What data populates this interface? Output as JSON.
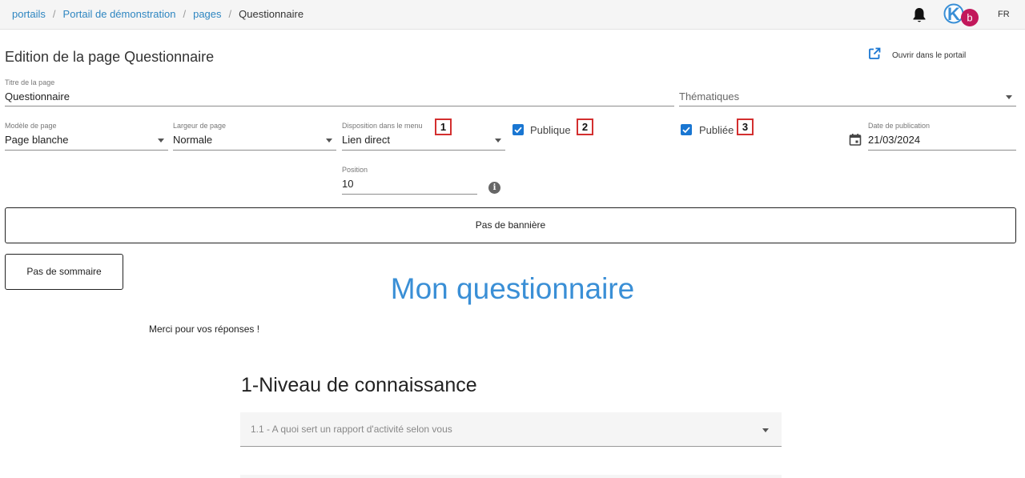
{
  "breadcrumb": {
    "items": [
      "portails",
      "Portail de démonstration",
      "pages"
    ],
    "current": "Questionnaire"
  },
  "header": {
    "logo_letter": "K",
    "avatar_letter": "b",
    "lang": "FR"
  },
  "page": {
    "title": "Edition de la page Questionnaire",
    "open_in_portal": "Ouvrir dans le portail"
  },
  "form": {
    "titre_label": "Titre de la page",
    "titre_value": "Questionnaire",
    "thematiques_placeholder": "Thématiques",
    "modele_label": "Modèle de page",
    "modele_value": "Page blanche",
    "largeur_label": "Largeur de page",
    "largeur_value": "Normale",
    "disposition_label": "Disposition dans le menu",
    "disposition_value": "Lien direct",
    "publique_label": "Publique",
    "publique_checked": true,
    "publiee_label": "Publiée",
    "publiee_checked": true,
    "date_label": "Date de publication",
    "date_value": "21/03/2024",
    "position_label": "Position",
    "position_value": "10",
    "info_glyph": "i"
  },
  "annotations": [
    "1",
    "2",
    "3"
  ],
  "buttons": {
    "banner": "Pas de bannière",
    "summary": "Pas de sommaire"
  },
  "content": {
    "heading": "Mon questionnaire",
    "thanks": "Merci pour vos réponses !",
    "section_title": "1-Niveau de connaissance",
    "question_1": "1.1 - A quoi sert un rapport d'activité selon vous"
  },
  "colors": {
    "link": "#2e86c1",
    "accent": "#1976d2",
    "heading": "#3a8fd6",
    "annotation_border": "#d32f2f",
    "avatar": "#c2185b"
  }
}
